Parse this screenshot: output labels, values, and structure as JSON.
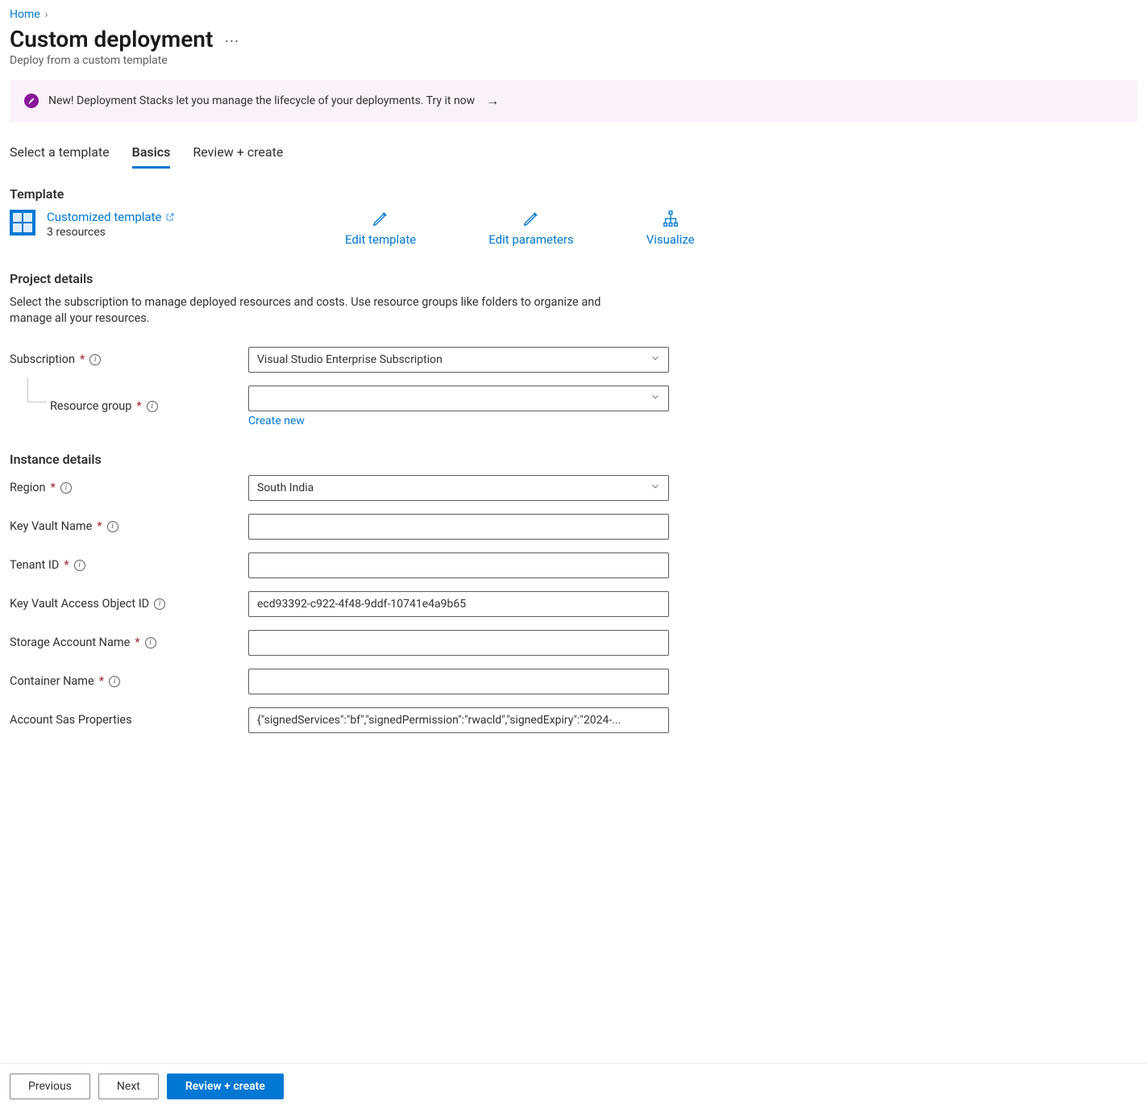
{
  "breadcrumb": {
    "home": "Home"
  },
  "header": {
    "title": "Custom deployment",
    "subtitle": "Deploy from a custom template"
  },
  "banner": {
    "text": "New! Deployment Stacks let you manage the lifecycle of your deployments. Try it now"
  },
  "tabs": {
    "select_template": "Select a template",
    "basics": "Basics",
    "review_create": "Review + create"
  },
  "template_section": {
    "heading": "Template",
    "link": "Customized template",
    "resources": "3 resources",
    "actions": {
      "edit_template": "Edit template",
      "edit_params": "Edit parameters",
      "visualize": "Visualize"
    }
  },
  "project_details": {
    "heading": "Project details",
    "description": "Select the subscription to manage deployed resources and costs. Use resource groups like folders to organize and manage all your resources.",
    "subscription": {
      "label": "Subscription",
      "value": "Visual Studio Enterprise Subscription"
    },
    "resource_group": {
      "label": "Resource group",
      "value": "",
      "create_new": "Create new"
    }
  },
  "instance_details": {
    "heading": "Instance details",
    "region": {
      "label": "Region",
      "value": "South India"
    },
    "key_vault_name": {
      "label": "Key Vault Name",
      "value": ""
    },
    "tenant_id": {
      "label": "Tenant ID",
      "value": ""
    },
    "kv_access_object_id": {
      "label": "Key Vault Access Object ID",
      "value": "ecd93392-c922-4f48-9ddf-10741e4a9b65"
    },
    "storage_account_name": {
      "label": "Storage Account Name",
      "value": ""
    },
    "container_name": {
      "label": "Container Name",
      "value": ""
    },
    "account_sas": {
      "label": "Account Sas Properties",
      "value": "{\"signedServices\":\"bf\",\"signedPermission\":\"rwacld\",\"signedExpiry\":\"2024-..."
    }
  },
  "footer": {
    "previous": "Previous",
    "next": "Next",
    "review_create": "Review + create"
  }
}
